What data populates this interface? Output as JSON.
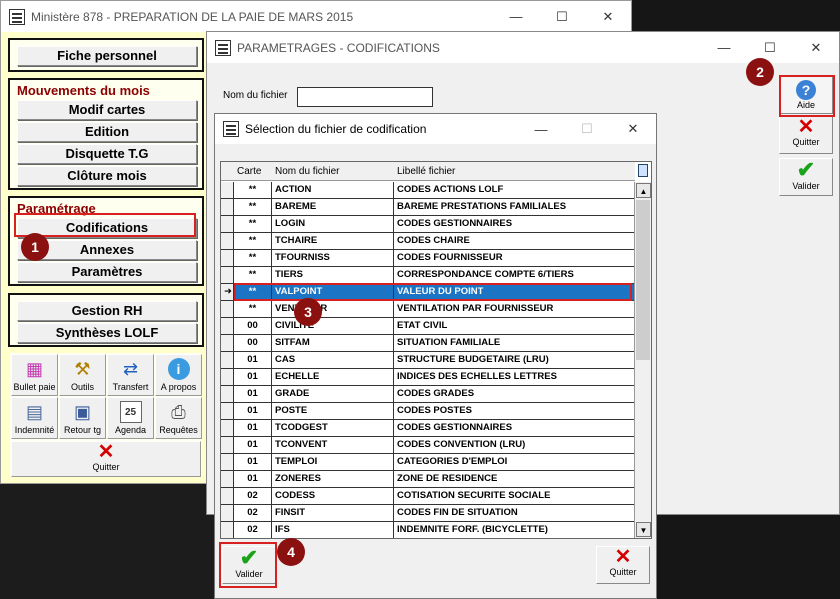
{
  "main_window": {
    "title": "Ministère 878 - PREPARATION DE LA PAIE DE MARS 2015",
    "btn_min": "—",
    "btn_max": "☐",
    "btn_close": "✕",
    "group1": {
      "items": [
        "Fiche personnel"
      ]
    },
    "group2": {
      "heading": "Mouvements du mois",
      "items": [
        "Modif cartes",
        "Edition",
        "Disquette T.G",
        "Clôture mois"
      ]
    },
    "group3": {
      "heading": "Paramétrage",
      "items": [
        "Codifications",
        "Annexes",
        "Paramètres"
      ]
    },
    "group4": {
      "items": [
        "Gestion RH",
        "Synthèses LOLF"
      ]
    },
    "toolbar": {
      "items": [
        "Bullet paie",
        "Outils",
        "Transfert",
        "A propos",
        "Indemnité",
        "Retour tg",
        "Agenda",
        "Requêtes"
      ],
      "quit": "Quitter"
    }
  },
  "param_window": {
    "title": "PARAMETRAGES - CODIFICATIONS",
    "btn_min": "—",
    "btn_max": "☐",
    "btn_close": "✕",
    "field_label": "Nom du fichier",
    "field_value": "",
    "help": "Aide",
    "quit": "Quitter",
    "validate": "Valider"
  },
  "dialog": {
    "title": "Sélection du fichier de codification",
    "btn_min": "—",
    "btn_max": "☐",
    "btn_close": "✕",
    "columns": [
      "Carte",
      "Nom du fichier",
      "Libellé fichier"
    ],
    "rows": [
      [
        "**",
        "ACTION",
        "CODES ACTIONS LOLF"
      ],
      [
        "**",
        "BAREME",
        "BAREME PRESTATIONS FAMILIALES"
      ],
      [
        "**",
        "LOGIN",
        "CODES GESTIONNAIRES"
      ],
      [
        "**",
        "TCHAIRE",
        "CODES CHAIRE"
      ],
      [
        "**",
        "TFOURNISS",
        "CODES FOURNISSEUR"
      ],
      [
        "**",
        "TIERS",
        "CORRESPONDANCE COMPTE 6/TIERS"
      ],
      [
        "**",
        "VALPOINT",
        "VALEUR DU POINT"
      ],
      [
        "**",
        "VENTFOUR",
        "VENTILATION PAR FOURNISSEUR"
      ],
      [
        "00",
        "CIVILITE",
        "ETAT CIVIL"
      ],
      [
        "00",
        "SITFAM",
        "SITUATION FAMILIALE"
      ],
      [
        "01",
        "CAS",
        "STRUCTURE BUDGETAIRE (LRU)"
      ],
      [
        "01",
        "ECHELLE",
        "INDICES DES ECHELLES LETTRES"
      ],
      [
        "01",
        "GRADE",
        "CODES GRADES"
      ],
      [
        "01",
        "POSTE",
        "CODES POSTES"
      ],
      [
        "01",
        "TCODGEST",
        "CODES GESTIONNAIRES"
      ],
      [
        "01",
        "TCONVENT",
        "CODES CONVENTION (LRU)"
      ],
      [
        "01",
        "TEMPLOI",
        "CATEGORIES D'EMPLOI"
      ],
      [
        "01",
        "ZONERES",
        "ZONE DE RESIDENCE"
      ],
      [
        "02",
        "CODESS",
        "COTISATION SECURITE SOCIALE"
      ],
      [
        "02",
        "FINSIT",
        "CODES FIN DE SITUATION"
      ],
      [
        "02",
        "IFS",
        "INDEMNITE FORF. (BICYCLETTE)"
      ]
    ],
    "selected_index": 6,
    "selected_marker": "➜",
    "validate": "Valider",
    "quit": "Quitter",
    "scroll_up": "▲",
    "scroll_down": "▼"
  },
  "annotations": [
    "1",
    "2",
    "3",
    "4"
  ],
  "colors": {
    "highlight": "#d92020",
    "badge": "#8b1010",
    "selection": "#1c74c4",
    "group_heading": "#8b0000"
  }
}
